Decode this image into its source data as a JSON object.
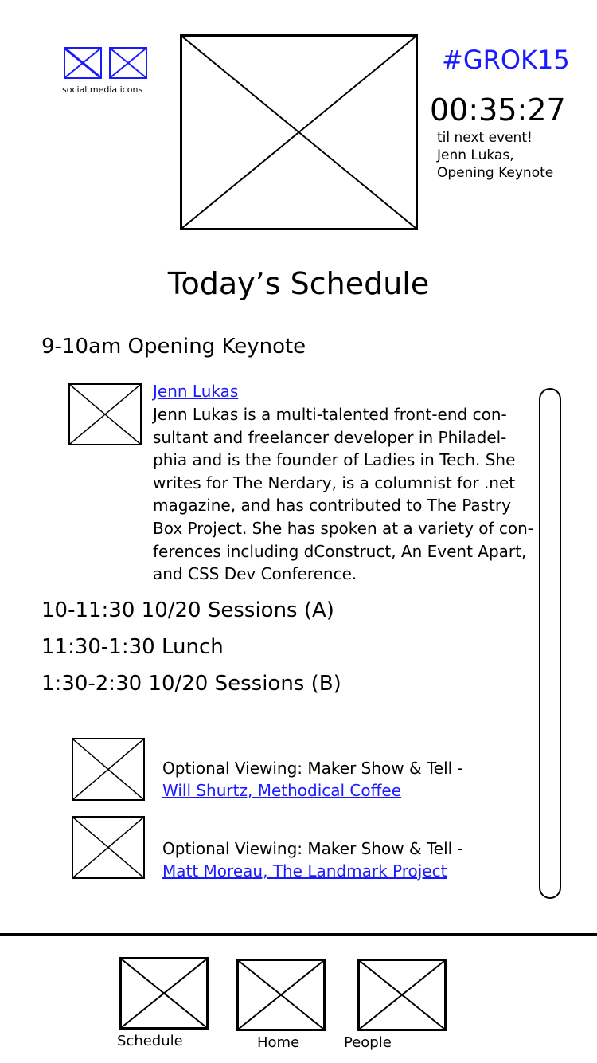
{
  "header": {
    "social_caption": "social media icons",
    "hashtag": "#GROK15",
    "countdown": "00:35:27",
    "next_event": {
      "line1": "til next event!",
      "line2": "Jenn Lukas,",
      "line3": "Opening Keynote"
    }
  },
  "schedule": {
    "title": "Today’s Schedule",
    "slots": [
      {
        "label": "9-10am Opening Keynote"
      },
      {
        "label": "10-11:30 10/20 Sessions (A)"
      },
      {
        "label": "11:30-1:30 Lunch"
      },
      {
        "label": "1:30-2:30 10/20 Sessions (B)"
      }
    ],
    "speaker": {
      "name": "Jenn Lukas",
      "bio_lines": [
        "Jenn Lukas is a multi-talented front-end con-",
        "sultant and freelancer developer in Philadel-",
        "phia and is the founder of Ladies in Tech. She",
        "writes for The Nerdary, is a columnist for .net",
        "magazine, and has contributed to The Pastry",
        "Box Project. She has spoken at a variety of con-",
        "ferences including dConstruct, An Event Apart,",
        "and CSS Dev Conference."
      ]
    },
    "optional": [
      {
        "label": "Optional Viewing: Maker Show & Tell -",
        "link": "Will Shurtz, Methodical Coffee"
      },
      {
        "label": "Optional Viewing: Maker Show & Tell -",
        "link": "Matt Moreau, The Landmark Project"
      }
    ]
  },
  "nav": {
    "items": [
      {
        "label": "Schedule"
      },
      {
        "label": "Home"
      },
      {
        "label": "People"
      }
    ]
  },
  "colors": {
    "link": "#1a1aff",
    "ink": "#000000",
    "background": "#ffffff"
  }
}
